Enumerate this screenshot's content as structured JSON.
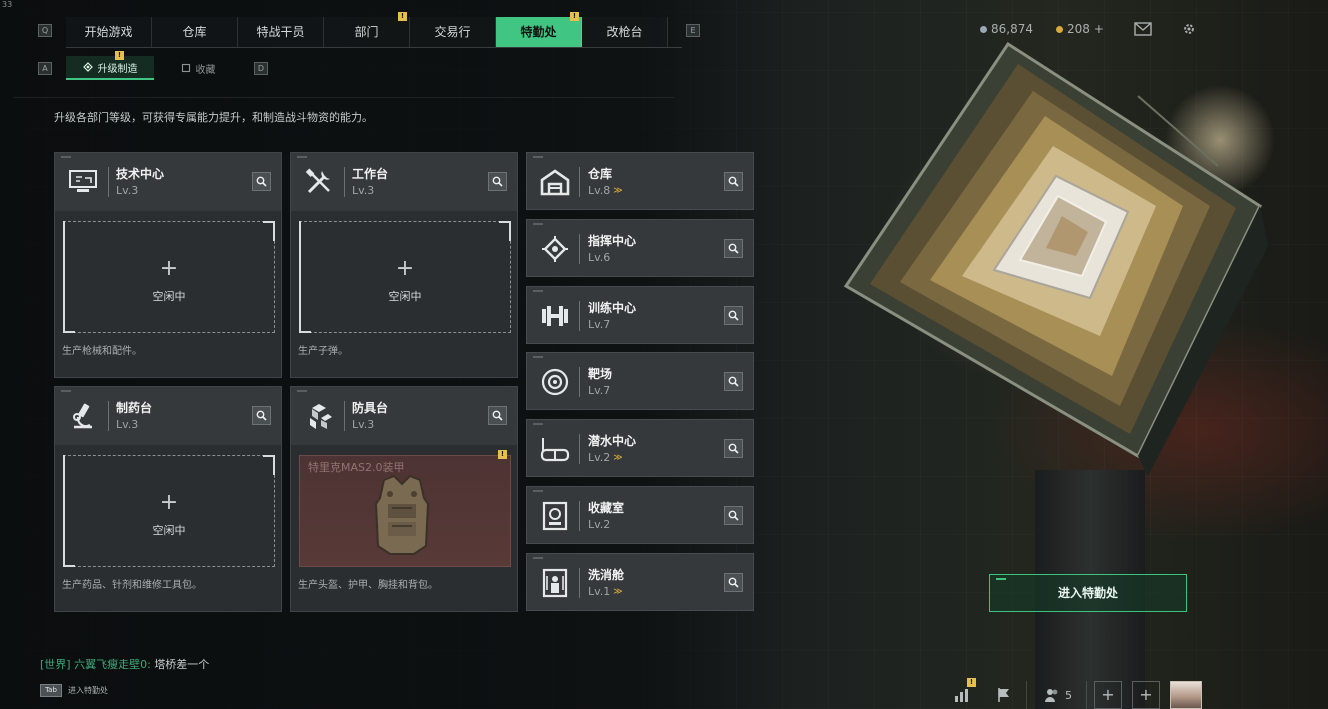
{
  "version_label": "33",
  "main_nav": {
    "left_key": "Q",
    "right_key": "E",
    "tabs": [
      {
        "label": "开始游戏",
        "active": false,
        "badge": false
      },
      {
        "label": "仓库",
        "active": false,
        "badge": false
      },
      {
        "label": "特战干员",
        "active": false,
        "badge": false
      },
      {
        "label": "部门",
        "active": false,
        "badge": true
      },
      {
        "label": "交易行",
        "active": false,
        "badge": false
      },
      {
        "label": "特勤处",
        "active": true,
        "badge": true
      },
      {
        "label": "改枪台",
        "active": false,
        "badge": false
      }
    ],
    "badge_mark": "!"
  },
  "sub_nav": {
    "left_key": "A",
    "right_key": "D",
    "tabs": [
      {
        "label": "升级制造",
        "active": true,
        "badge": true
      },
      {
        "label": "收藏",
        "active": false,
        "badge": false
      }
    ]
  },
  "currency": {
    "coins": "86,874",
    "tickets": "208",
    "add": "+"
  },
  "description": "升级各部门等级，可获得专属能力提升，和制造战斗物资的能力。",
  "stations": [
    {
      "name": "技术中心",
      "level": "Lv.3",
      "icon": "computer-icon",
      "slot": "空闲中",
      "plus": "+",
      "footer": "生产枪械和配件。"
    },
    {
      "name": "工作台",
      "level": "Lv.3",
      "icon": "tools-icon",
      "slot": "空闲中",
      "plus": "+",
      "footer": "生产子弹。"
    },
    {
      "name": "制药台",
      "level": "Lv.3",
      "icon": "microscope-icon",
      "slot": "空闲中",
      "plus": "+",
      "footer": "生产药品、针剂和维修工具包。"
    },
    {
      "name": "防具台",
      "level": "Lv.3",
      "icon": "cubes-icon",
      "item": "特里克MAS2.0装甲",
      "footer": "生产头盔、护甲、胸挂和背包。"
    }
  ],
  "departments": [
    {
      "name": "仓库",
      "level": "Lv.8",
      "icon": "warehouse-icon",
      "upgrade": true
    },
    {
      "name": "指挥中心",
      "level": "Lv.6",
      "icon": "command-icon",
      "upgrade": false
    },
    {
      "name": "训练中心",
      "level": "Lv.7",
      "icon": "dumbbell-icon",
      "upgrade": false
    },
    {
      "name": "靶场",
      "level": "Lv.7",
      "icon": "target-icon",
      "upgrade": false
    },
    {
      "name": "潜水中心",
      "level": "Lv.2",
      "icon": "diving-mask-icon",
      "upgrade": true
    },
    {
      "name": "收藏室",
      "level": "Lv.2",
      "icon": "collection-icon",
      "upgrade": false
    },
    {
      "name": "洗消舱",
      "level": "Lv.1",
      "icon": "decon-icon",
      "upgrade": true
    }
  ],
  "upgrade_mark": "≫",
  "enter_button": "进入特勤处",
  "chat": {
    "channel": "[世界]",
    "user": "六翼飞瘦走壁0:",
    "message": "塔桥差一个"
  },
  "tab_hint": {
    "key": "Tab",
    "label": "进入特勤处"
  },
  "bottom_bar": {
    "party_count": "5",
    "plus": "+"
  },
  "colors": {
    "accent": "#41c583",
    "badge": "#e6c04a",
    "card_bg": "#36393b",
    "item_bg": "#583a38"
  }
}
